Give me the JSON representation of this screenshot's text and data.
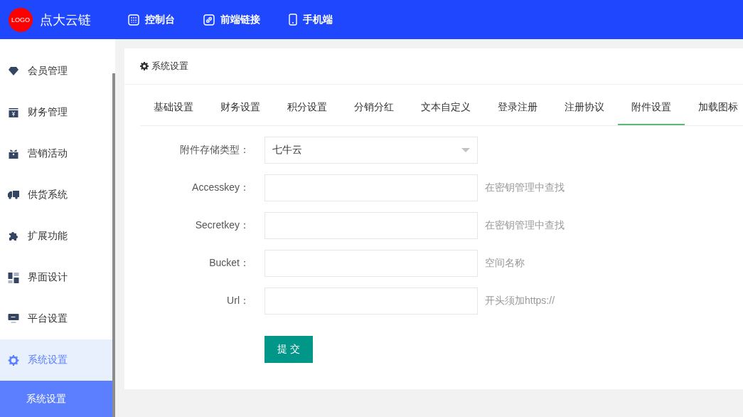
{
  "header": {
    "logo": "LOGO",
    "brand": "点大云链",
    "nav": [
      {
        "kind": "console",
        "label": "控制台"
      },
      {
        "kind": "link",
        "label": "前端链接"
      },
      {
        "kind": "mobile",
        "label": "手机端"
      }
    ]
  },
  "sidebar": {
    "items": [
      {
        "kind": "gem",
        "label": "会员管理",
        "selected": false
      },
      {
        "kind": "money",
        "label": "财务管理",
        "selected": false
      },
      {
        "kind": "gift",
        "label": "营销活动",
        "selected": false
      },
      {
        "kind": "truck",
        "label": "供货系统",
        "selected": false
      },
      {
        "kind": "puzzle",
        "label": "扩展功能",
        "selected": false
      },
      {
        "kind": "grid",
        "label": "界面设计",
        "selected": false
      },
      {
        "kind": "monitor",
        "label": "平台设置",
        "selected": false
      },
      {
        "kind": "gear",
        "label": "系统设置",
        "selected": true,
        "children": [
          {
            "label": "系统设置",
            "selected": true
          }
        ]
      }
    ]
  },
  "panel": {
    "title": "系统设置",
    "tabs": [
      {
        "label": "基础设置",
        "selected": false
      },
      {
        "label": "财务设置",
        "selected": false
      },
      {
        "label": "积分设置",
        "selected": false
      },
      {
        "label": "分销分红",
        "selected": false
      },
      {
        "label": "文本自定义",
        "selected": false
      },
      {
        "label": "登录注册",
        "selected": false
      },
      {
        "label": "注册协议",
        "selected": false
      },
      {
        "label": "附件设置",
        "selected": true
      },
      {
        "label": "加载图标",
        "selected": false
      }
    ],
    "form": [
      {
        "kind": "select",
        "label": "附件存储类型：",
        "value": "七牛云"
      },
      {
        "kind": "input",
        "label": "Accesskey：",
        "hint": "在密钥管理中查找"
      },
      {
        "kind": "input",
        "label": "Secretkey：",
        "hint": "在密钥管理中查找"
      },
      {
        "kind": "input",
        "label": "Bucket：",
        "hint": "空间名称"
      },
      {
        "kind": "input",
        "label": "Url：",
        "hint": "开头须加https://"
      }
    ],
    "submit": "提 交"
  }
}
